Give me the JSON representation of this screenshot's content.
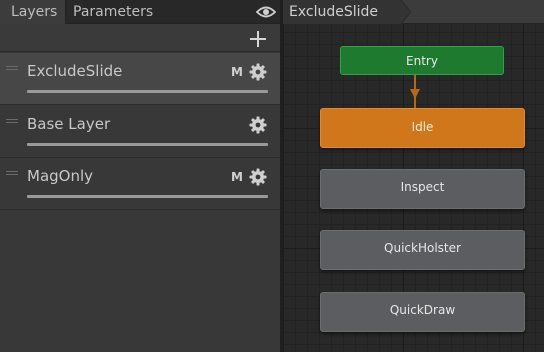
{
  "tabs": [
    {
      "label": "Layers",
      "active": true
    },
    {
      "label": "Parameters",
      "active": false
    }
  ],
  "layers": [
    {
      "name": "ExcludeSlide",
      "badge": "M",
      "selected": true
    },
    {
      "name": "Base Layer",
      "badge": "",
      "selected": false
    },
    {
      "name": "MagOnly",
      "badge": "M",
      "selected": false
    }
  ],
  "breadcrumb": "ExcludeSlide",
  "states": {
    "entry": "Entry",
    "idle": "Idle",
    "inspect": "Inspect",
    "quick_holster": "QuickHolster",
    "quick_draw": "QuickDraw"
  },
  "colors": {
    "entry": "#1e7a2e",
    "default_state": "#d0771b",
    "state": "#5b5d60",
    "transition": "#b36a10"
  },
  "icons": {
    "visibility": "eye-icon",
    "add": "plus-icon",
    "settings": "gear-icon"
  }
}
